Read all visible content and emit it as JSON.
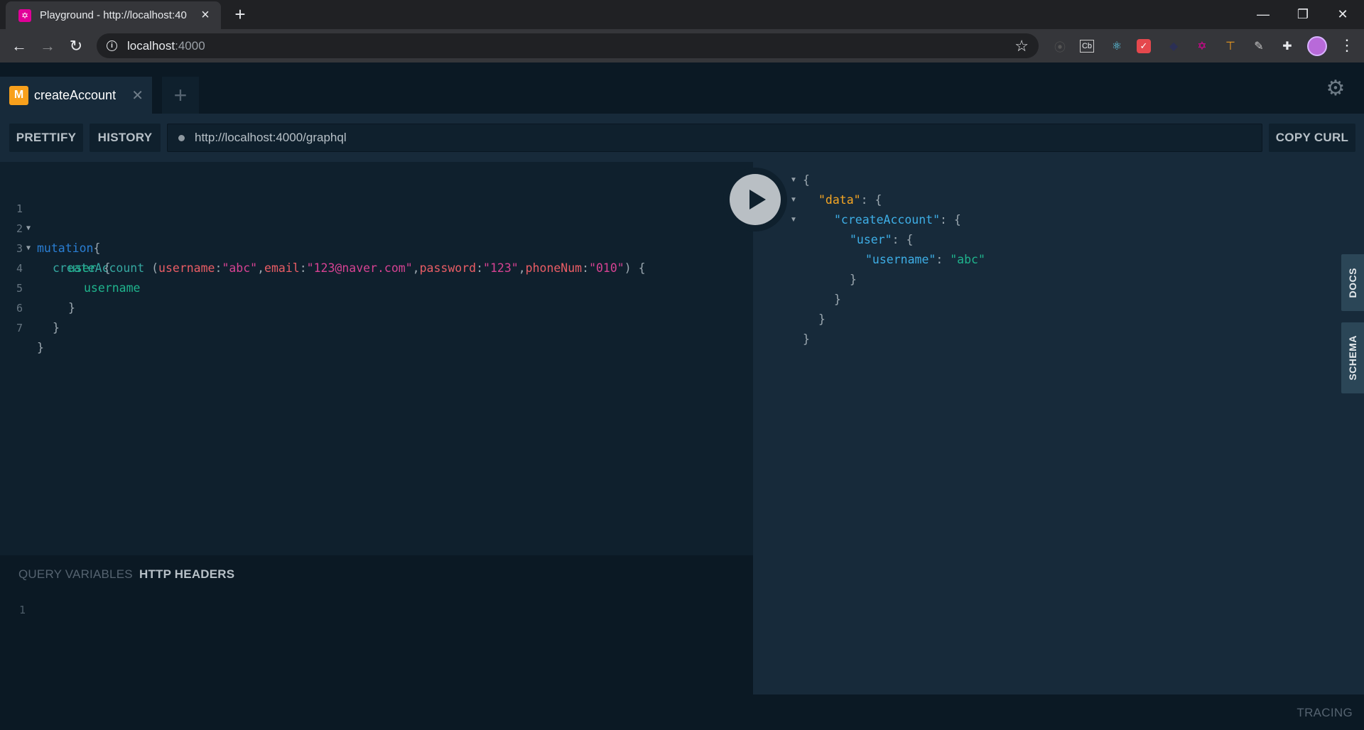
{
  "browser": {
    "tab_title": "Playground - http://localhost:40",
    "url_host": "localhost",
    "url_port": ":4000"
  },
  "playground": {
    "tabs": [
      {
        "badge": "M",
        "name": "createAccount"
      }
    ],
    "prettify_label": "PRETTIFY",
    "history_label": "HISTORY",
    "endpoint": "http://localhost:4000/graphql",
    "copy_curl_label": "COPY CURL",
    "docs_label": "DOCS",
    "schema_label": "SCHEMA",
    "query_variables_label": "QUERY VARIABLES",
    "http_headers_label": "HTTP HEADERS",
    "tracing_label": "TRACING",
    "accent_colors": {
      "mutation_badge": "#f8a01c",
      "keyword": "#2a7ed3",
      "string": "#d64292",
      "field": "#1fb48d",
      "argument": "#ea5d65"
    }
  },
  "editor": {
    "line_numbers": [
      "1",
      "2",
      "3",
      "4",
      "5",
      "6",
      "7"
    ],
    "l1": {
      "kw": "mutation",
      "brace": "{"
    },
    "l2": {
      "fn": "createAccount",
      "open": " (",
      "a1": "username",
      "v1": "\"abc\"",
      "a2": "email",
      "v2": "\"123@naver.com\"",
      "a3": "password",
      "v3": "\"123\"",
      "a4": "phoneNum",
      "v4": "\"010\"",
      "close": ") {"
    },
    "l3": {
      "field": "user",
      "brace": " {"
    },
    "l4": {
      "field": "username"
    },
    "l5": "}",
    "l6": "}",
    "l7": "}",
    "colon": ":",
    "comma": ","
  },
  "result": {
    "open": "{",
    "data_key": "\"data\"",
    "create_key": "\"createAccount\"",
    "user_key": "\"user\"",
    "username_key": "\"username\"",
    "username_val": "\"abc\"",
    "sep_obj": ": {",
    "sep_val": ": ",
    "close": "}"
  },
  "variables": {
    "line_numbers": [
      "1"
    ]
  }
}
